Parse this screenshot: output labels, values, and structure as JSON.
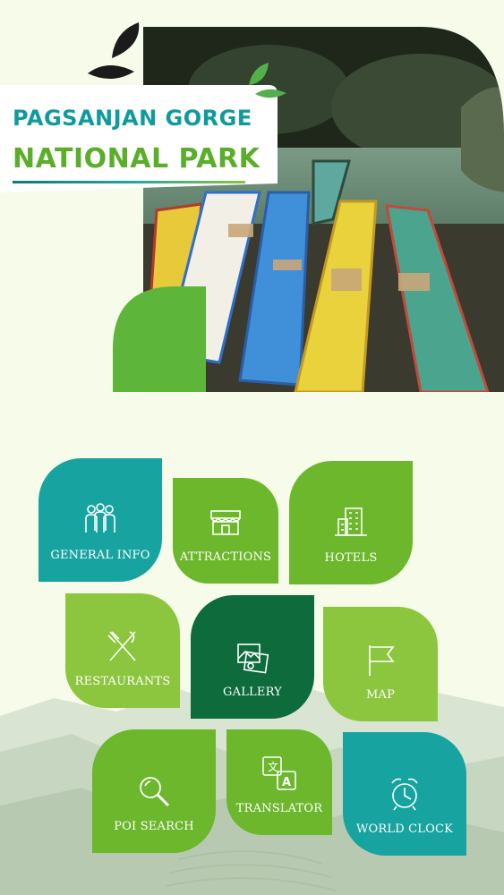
{
  "header": {
    "title_line1": "PAGSANJAN GORGE",
    "title_line2": "NATIONAL PARK"
  },
  "colors": {
    "background": "#f6fbea",
    "teal": "#17a4a0",
    "green": "#6cb72c",
    "light_green": "#8cc63e",
    "dark_green": "#0d6b3c"
  },
  "menu": {
    "general_info": "GENERAL INFO",
    "attractions": "ATTRACTIONS",
    "hotels": "HOTELS",
    "restaurants": "RESTAURANTS",
    "gallery": "GALLERY",
    "map": "MAP",
    "poi_search": "POI SEARCH",
    "translator": "TRANSLATOR",
    "world_clock": "WORLD CLOCK"
  },
  "icons": {
    "general_info": "people-icon",
    "attractions": "storefront-icon",
    "hotels": "building-icon",
    "restaurants": "cutlery-icon",
    "gallery": "photos-icon",
    "map": "flag-icon",
    "poi_search": "magnifier-icon",
    "translator": "translate-icon",
    "world_clock": "alarm-clock-icon"
  }
}
